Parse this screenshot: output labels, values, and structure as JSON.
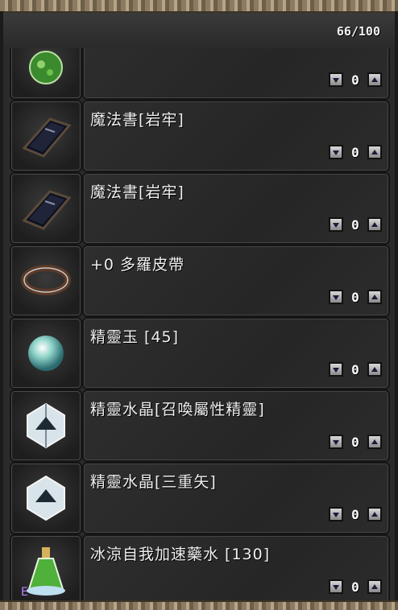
{
  "capacity": "66/100",
  "items": [
    {
      "name": "",
      "qty": "0",
      "icon": "green-potion-icon"
    },
    {
      "name": "魔法書[岩牢]",
      "qty": "0",
      "icon": "spellbook-icon"
    },
    {
      "name": "魔法書[岩牢]",
      "qty": "0",
      "icon": "spellbook-icon"
    },
    {
      "name": "+0 多羅皮帶",
      "qty": "0",
      "icon": "belt-icon"
    },
    {
      "name": "精靈玉 [45]",
      "qty": "0",
      "icon": "spirit-orb-icon"
    },
    {
      "name": "精靈水晶[召喚屬性精靈]",
      "qty": "0",
      "icon": "crystal-icon"
    },
    {
      "name": "精靈水晶[三重矢]",
      "qty": "0",
      "icon": "crystal-icon"
    },
    {
      "name": "冰涼自我加速藥水 [130]",
      "qty": "0",
      "icon": "cooling-haste-potion-icon"
    }
  ]
}
